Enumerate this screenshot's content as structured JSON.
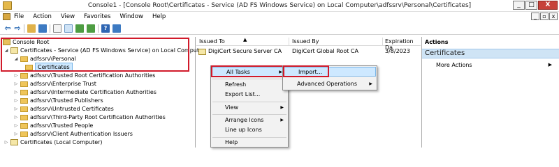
{
  "window": {
    "title": "Console1 - [Console Root\\Certificates - Service (AD FS Windows Service) on Local Computer\\adfssrv\\Personal\\Certificates]",
    "minimize": "_",
    "maximize": "□",
    "close": "X"
  },
  "menubar": {
    "items": [
      "File",
      "Action",
      "View",
      "Favorites",
      "Window",
      "Help"
    ],
    "inner_minimize": "_",
    "inner_restore": "▫",
    "inner_close": "x"
  },
  "tree": {
    "rows": [
      {
        "label": "Console Root"
      },
      {
        "label": "Certificates - Service (AD FS Windows Service) on Local Computer"
      },
      {
        "label": "adfssrv\\Personal"
      },
      {
        "label": "Certificates"
      },
      {
        "label": "adfssrv\\Trusted Root Certification Authorities"
      },
      {
        "label": "adfssrv\\Enterprise Trust"
      },
      {
        "label": "adfssrv\\Intermediate Certification Authorities"
      },
      {
        "label": "adfssrv\\Trusted Publishers"
      },
      {
        "label": "adfssrv\\Untrusted Certificates"
      },
      {
        "label": "adfssrv\\Third-Party Root Certification Authorities"
      },
      {
        "label": "adfssrv\\Trusted People"
      },
      {
        "label": "adfssrv\\Client Authentication Issuers"
      },
      {
        "label": "Certificates (Local Computer)"
      }
    ]
  },
  "list": {
    "columns": [
      "Issued To",
      "Issued By",
      "Expiration Da"
    ],
    "rows": [
      {
        "issued_to": "DigiCert Secure Server CA",
        "issued_by": "DigiCert Global Root CA",
        "expiration": "3/8/2023"
      }
    ]
  },
  "actions": {
    "title": "Actions",
    "section": "Certificates",
    "item": "More Actions"
  },
  "context_menu": {
    "items": [
      "All Tasks",
      "Refresh",
      "Export List...",
      "View",
      "Arrange Icons",
      "Line up Icons",
      "Help"
    ]
  },
  "submenu": {
    "items": [
      "Import...",
      "Advanced Operations"
    ]
  },
  "colors": {
    "highlight_box": "#d11a2a",
    "selection": "#cde8ff",
    "actions_selection": "#cfe4f5"
  }
}
